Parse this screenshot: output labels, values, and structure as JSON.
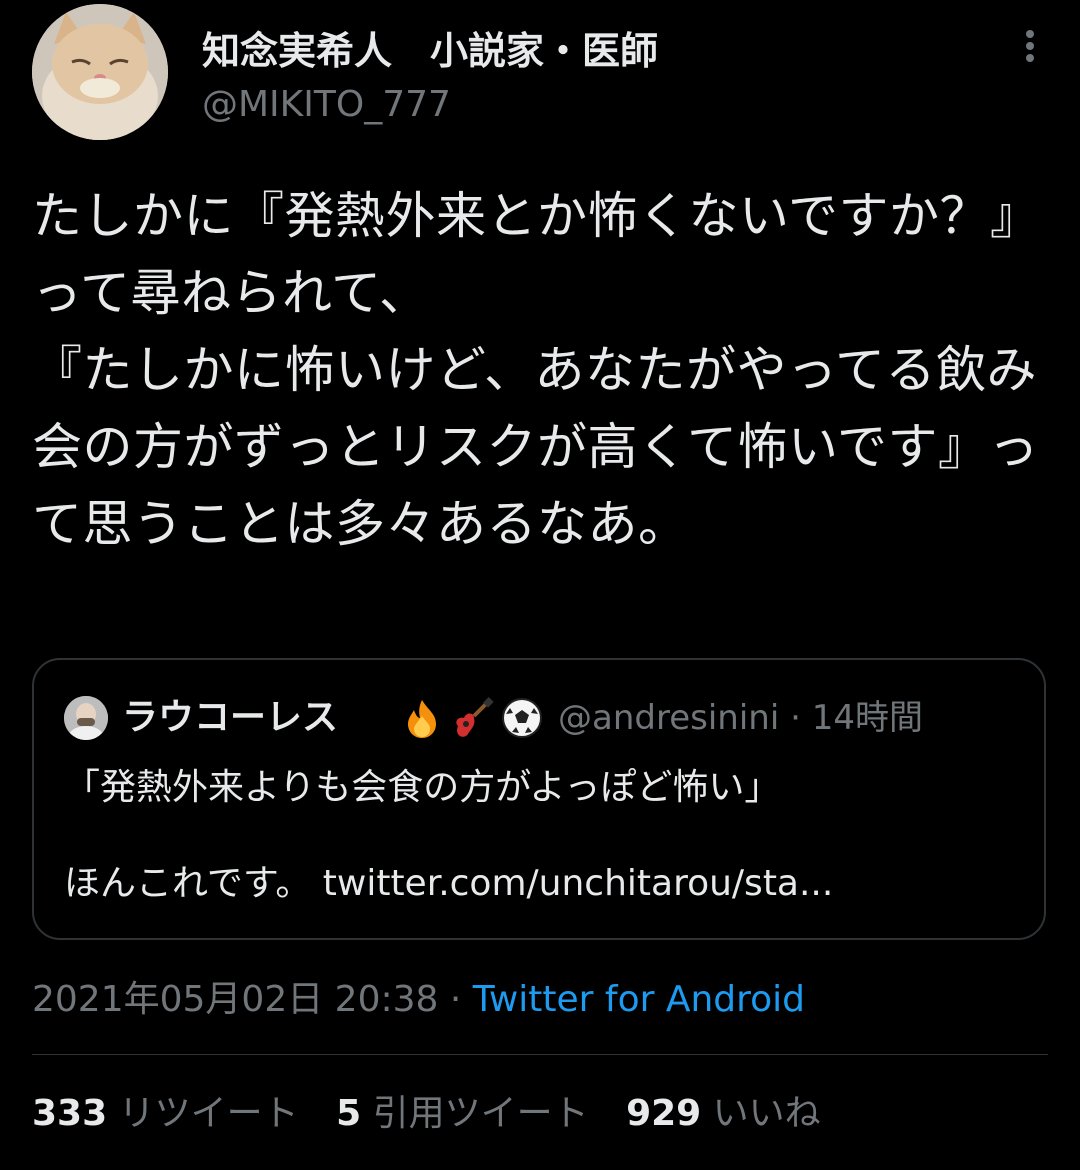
{
  "author": {
    "name": "知念実希人　小説家・医師",
    "handle": "@MIKITO_777",
    "avatar_icon": "cat-avatar"
  },
  "tweet": {
    "text": "たしかに『発熱外来とか怖くないですか？』って尋ねられて、\n『たしかに怖いけど、あなたがやってる飲み会の方がずっとリスクが高くて怖いです』って思うことは多々あるなあ。"
  },
  "quote": {
    "name": "ラウコーレス",
    "emojis": [
      "fire-icon",
      "guitar-icon",
      "soccer-ball-icon"
    ],
    "handle": "@andresinini",
    "time": "14時間",
    "text": "「発熱外来よりも会食の方がよっぽど怖い」\n\nほんこれです。 twitter.com/unchitarou/sta..."
  },
  "meta": {
    "timestamp": "2021年05月02日 20:38",
    "separator": "·",
    "source": "Twitter for Android"
  },
  "stats": {
    "retweets_count": "333",
    "retweets_label": "リツイート",
    "quotes_count": "5",
    "quotes_label": "引用ツイート",
    "likes_count": "929",
    "likes_label": "いいね"
  },
  "colors": {
    "background": "#000000",
    "text": "#e7e9ea",
    "secondary": "#71767b",
    "link": "#1d9bf0",
    "border": "#2f3336"
  }
}
